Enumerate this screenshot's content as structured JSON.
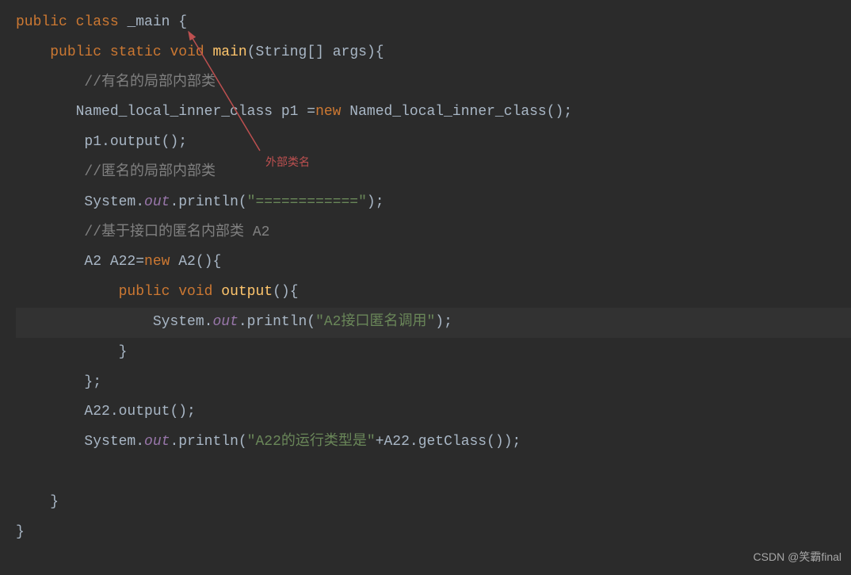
{
  "code": {
    "line1": {
      "keyword1": "public",
      "keyword2": "class",
      "className": "_main",
      "brace": "{"
    },
    "line2": {
      "keyword1": "public",
      "keyword2": "static",
      "keyword3": "void",
      "method": "main",
      "params": "(String[] args){"
    },
    "line3": {
      "comment": "//有名的局部内部类"
    },
    "line4": {
      "type1": "Named_local_inner_class p1 =",
      "keyword": "new",
      "type2": " Named_local_inner_class();"
    },
    "line5": {
      "text": " p1.output();"
    },
    "line6": {
      "comment": " //匿名的局部内部类"
    },
    "line7": {
      "obj": " System.",
      "field": "out",
      "method": ".println(",
      "string": "\"============\"",
      "end": ");"
    },
    "line8": {
      "comment": "//基于接口的匿名内部类 A2"
    },
    "line9": {
      "text1": "A2 A22=",
      "keyword": "new",
      "text2": " A2(){"
    },
    "line10": {
      "keyword1": "public",
      "keyword2": "void",
      "method": "output",
      "params": "(){"
    },
    "line11": {
      "obj": "System.",
      "field": "out",
      "method": ".println(",
      "string": "\"A2接口匿名调用\"",
      "end": ");"
    },
    "line12": {
      "brace": "}"
    },
    "line13": {
      "brace": "};"
    },
    "line14": {
      "text": "A22.output();"
    },
    "line15": {
      "obj": "System.",
      "field": "out",
      "method": ".println(",
      "string": "\"A22的运行类型是\"",
      "rest": "+A22.getClass());"
    },
    "line16": {
      "brace": "}"
    },
    "line17": {
      "brace": "}"
    }
  },
  "annotation": {
    "label": "外部类名"
  },
  "watermark": "CSDN @笑霸final"
}
